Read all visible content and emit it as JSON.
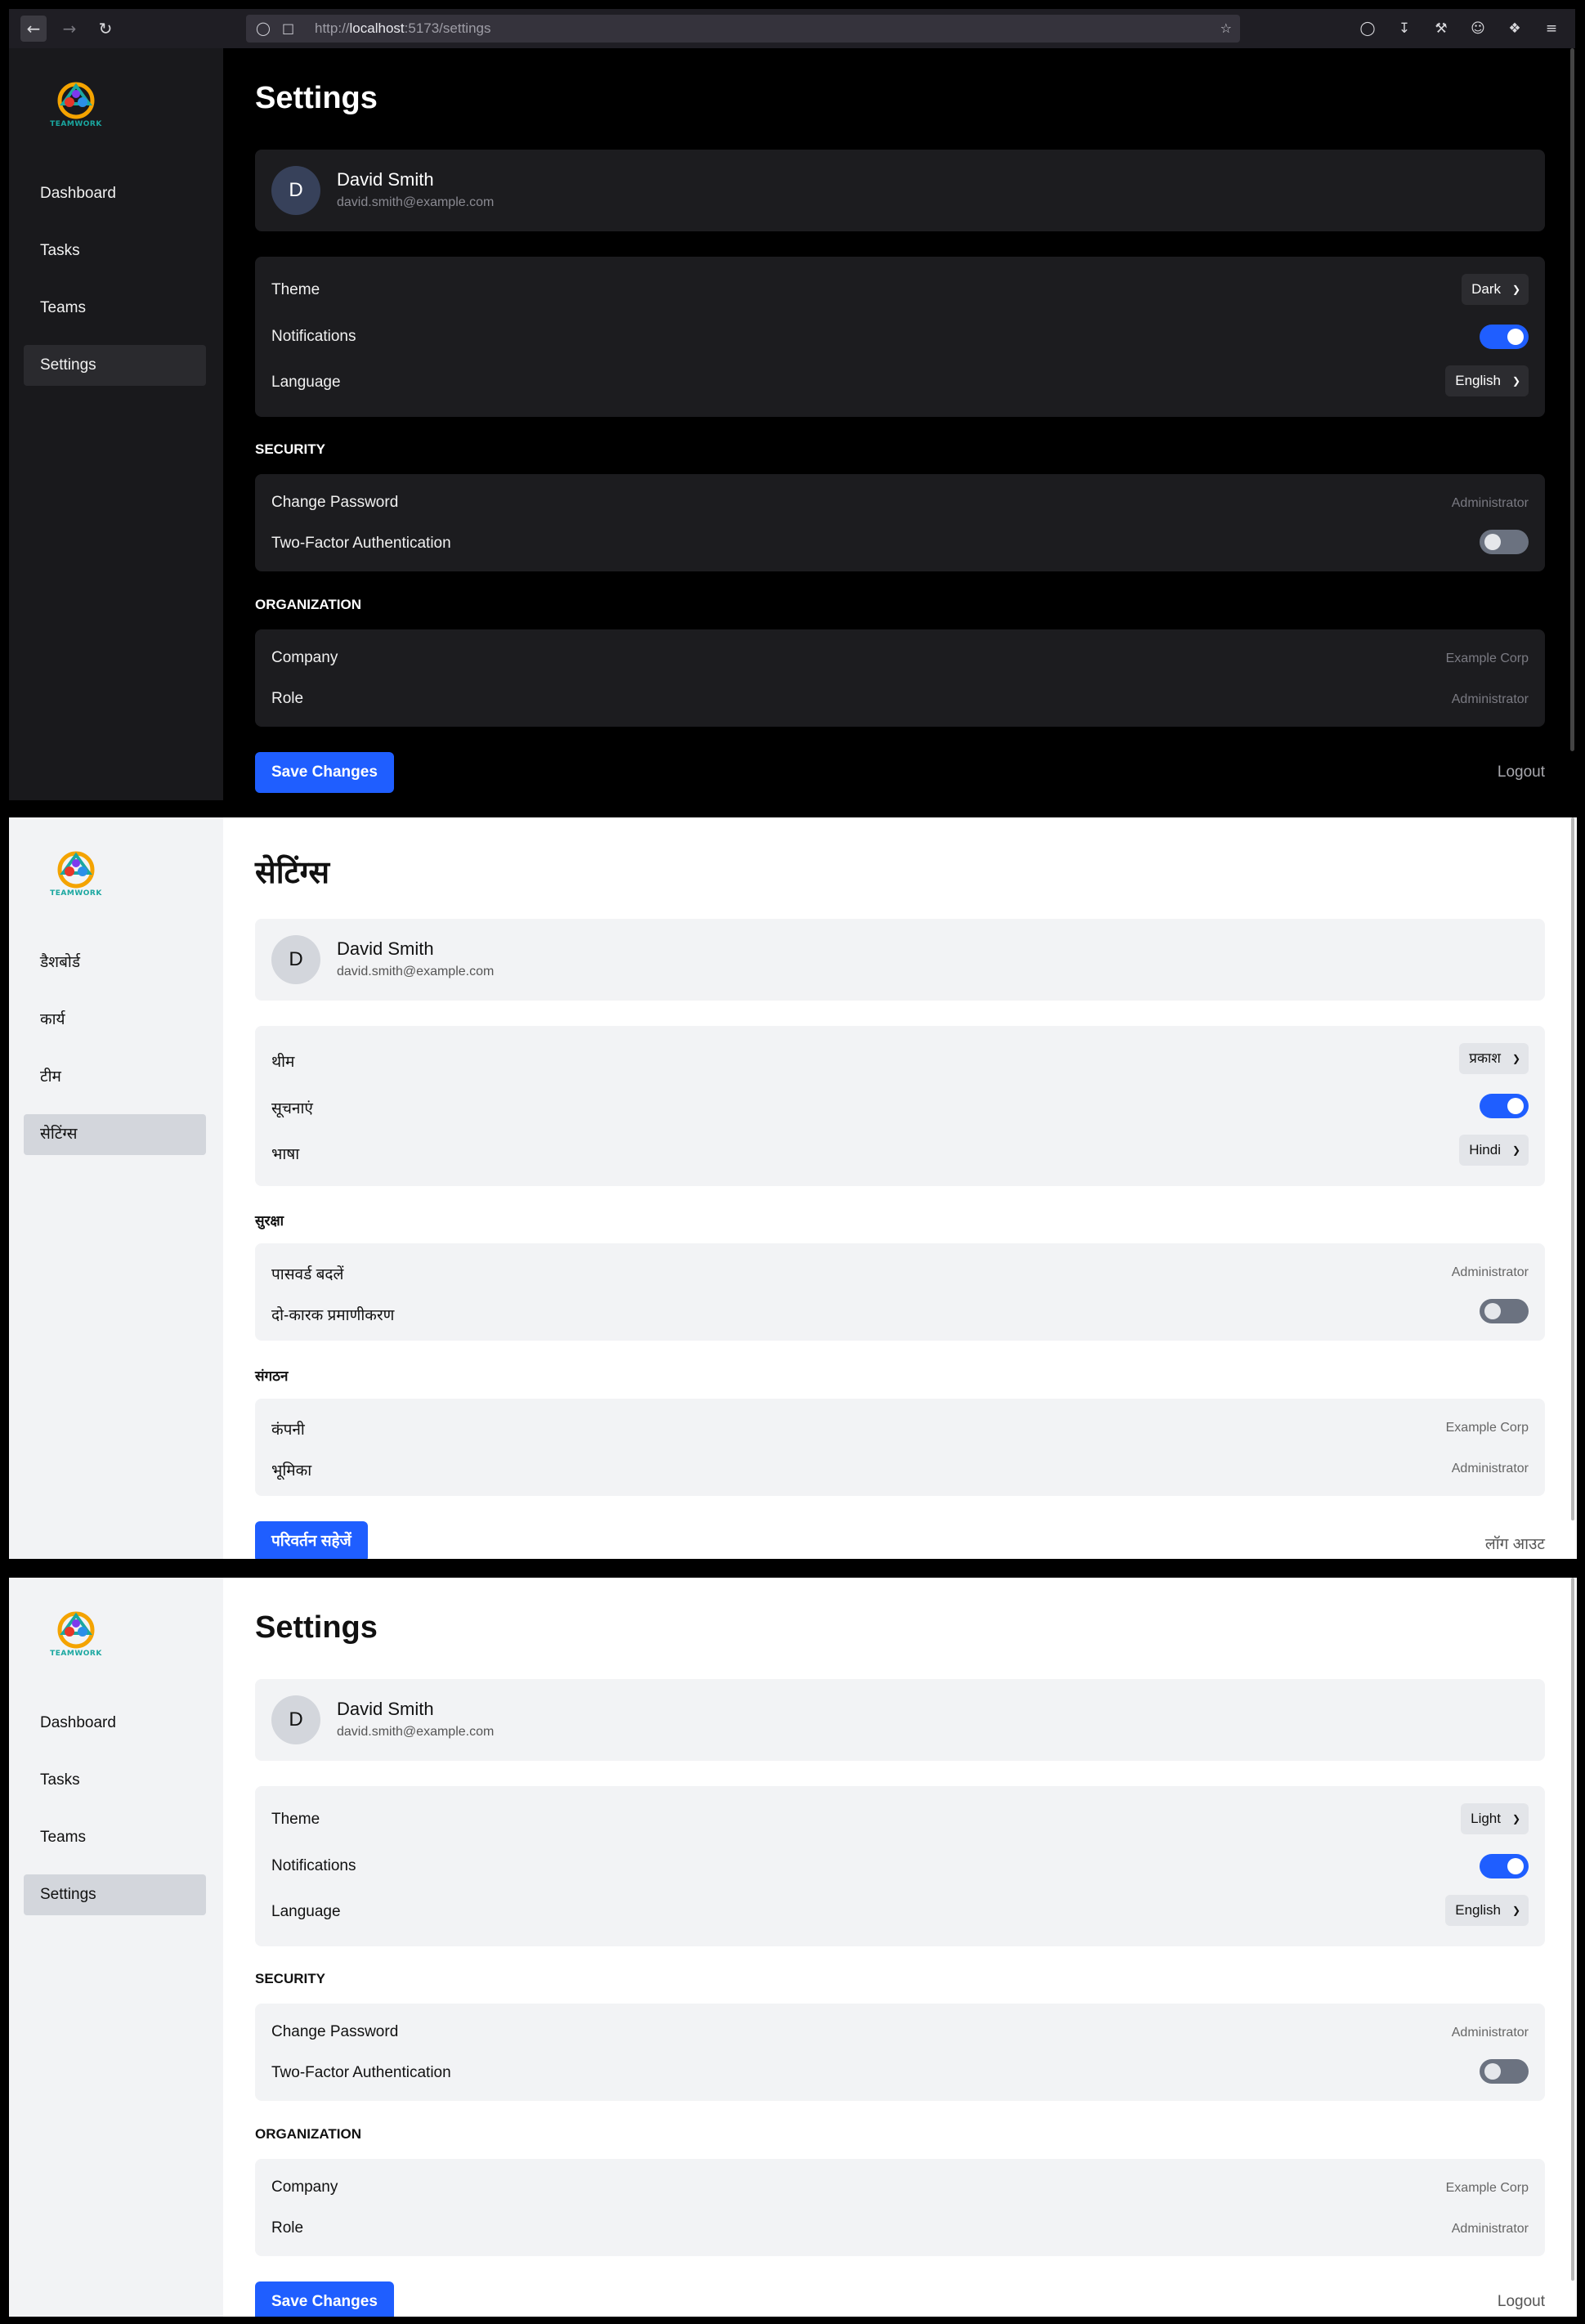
{
  "browser": {
    "url_prefix": "http://",
    "url_host": "localhost",
    "url_path": ":5173/settings"
  },
  "app": {
    "logo_text": "TEAMWORK"
  },
  "panels": [
    {
      "theme_mode": "dark",
      "nav": [
        "Dashboard",
        "Tasks",
        "Teams",
        "Settings"
      ],
      "active_nav": 3,
      "title": "Settings",
      "profile": {
        "initial": "D",
        "name": "David Smith",
        "email": "david.smith@example.com"
      },
      "prefs": {
        "theme_label": "Theme",
        "theme_value": "Dark",
        "notifications_label": "Notifications",
        "notifications_on": true,
        "language_label": "Language",
        "language_value": "English"
      },
      "security": {
        "heading": "SECURITY",
        "change_password_label": "Change Password",
        "change_password_value": "Administrator",
        "two_factor_label": "Two-Factor Authentication",
        "two_factor_on": false
      },
      "organization": {
        "heading": "ORGANIZATION",
        "company_label": "Company",
        "company_value": "Example Corp",
        "role_label": "Role",
        "role_value": "Administrator"
      },
      "save_label": "Save Changes",
      "logout_label": "Logout"
    },
    {
      "theme_mode": "light",
      "nav": [
        "डैशबोर्ड",
        "कार्य",
        "टीम",
        "सेटिंग्स"
      ],
      "active_nav": 3,
      "title": "सेटिंग्स",
      "profile": {
        "initial": "D",
        "name": "David Smith",
        "email": "david.smith@example.com"
      },
      "prefs": {
        "theme_label": "थीम",
        "theme_value": "प्रकाश",
        "notifications_label": "सूचनाएं",
        "notifications_on": true,
        "language_label": "भाषा",
        "language_value": "Hindi"
      },
      "security": {
        "heading": "सुरक्षा",
        "change_password_label": "पासवर्ड बदलें",
        "change_password_value": "Administrator",
        "two_factor_label": "दो-कारक प्रमाणीकरण",
        "two_factor_on": false
      },
      "organization": {
        "heading": "संगठन",
        "company_label": "कंपनी",
        "company_value": "Example Corp",
        "role_label": "भूमिका",
        "role_value": "Administrator"
      },
      "save_label": "परिवर्तन सहेजें",
      "logout_label": "लॉग आउट"
    },
    {
      "theme_mode": "light",
      "nav": [
        "Dashboard",
        "Tasks",
        "Teams",
        "Settings"
      ],
      "active_nav": 3,
      "title": "Settings",
      "profile": {
        "initial": "D",
        "name": "David Smith",
        "email": "david.smith@example.com"
      },
      "prefs": {
        "theme_label": "Theme",
        "theme_value": "Light",
        "notifications_label": "Notifications",
        "notifications_on": true,
        "language_label": "Language",
        "language_value": "English"
      },
      "security": {
        "heading": "SECURITY",
        "change_password_label": "Change Password",
        "change_password_value": "Administrator",
        "two_factor_label": "Two-Factor Authentication",
        "two_factor_on": false
      },
      "organization": {
        "heading": "ORGANIZATION",
        "company_label": "Company",
        "company_value": "Example Corp",
        "role_label": "Role",
        "role_value": "Administrator"
      },
      "save_label": "Save Changes",
      "logout_label": "Logout"
    }
  ]
}
